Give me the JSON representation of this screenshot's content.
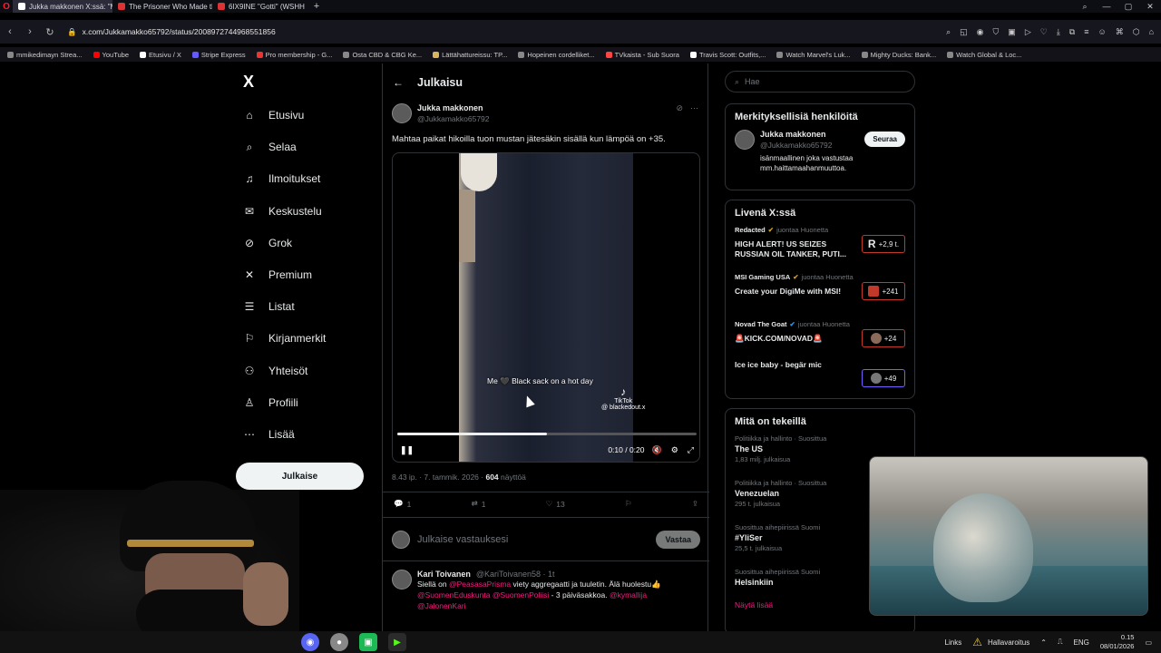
{
  "browser": {
    "tabs": [
      {
        "label": "Jukka makkonen X:ssä: \"M",
        "active": true
      },
      {
        "label": "The Prisoner Who Made th",
        "active": false
      },
      {
        "label": "6IX9INE \"Gotti\" (WSHH",
        "active": false
      }
    ],
    "new_tab": "+",
    "url": "x.com/Jukkamakko65792/status/2008972744968551856",
    "bookmarks": [
      "mmikedimayn Strea...",
      "YouTube",
      "Etusivu / X",
      "Stripe Express",
      "Pro membership - G...",
      "Osta CBD & CBG Ke...",
      "Lättähattureissu: TP...",
      "Hopeinen cordelliket...",
      "TVkaista - Sub Suora",
      "Travis Scott: Outfits,...",
      "Watch Marvel's Luk...",
      "Mighty Ducks: Bank...",
      "Watch Global & Loc..."
    ]
  },
  "nav": {
    "logo": "X",
    "items": [
      {
        "label": "Etusivu",
        "icon": "home-icon"
      },
      {
        "label": "Selaa",
        "icon": "search-icon"
      },
      {
        "label": "Ilmoitukset",
        "icon": "bell-icon"
      },
      {
        "label": "Keskustelu",
        "icon": "mail-icon"
      },
      {
        "label": "Grok",
        "icon": "grok-icon"
      },
      {
        "label": "Premium",
        "icon": "x-icon"
      },
      {
        "label": "Listat",
        "icon": "list-icon"
      },
      {
        "label": "Kirjanmerkit",
        "icon": "bookmark-icon"
      },
      {
        "label": "Yhteisöt",
        "icon": "people-icon"
      },
      {
        "label": "Profiili",
        "icon": "person-icon"
      },
      {
        "label": "Lisää",
        "icon": "more-icon"
      }
    ],
    "post_button": "Julkaise"
  },
  "post": {
    "header_title": "Julkaisu",
    "author_name": "Jukka makkonen",
    "author_handle": "@Jukkamakko65792",
    "text": "Mahtaa paikat hikoilla tuon mustan jätesäkin sisällä kun lämpöä on +35.",
    "video": {
      "caption": "Me 🖤 Black sack on a hot day",
      "watermark": "TikTok",
      "watermark_handle": "@ blackedout.x",
      "time": "0:10 / 0:20",
      "progress": 0.5
    },
    "meta_time": "8.43 ip. · 7. tammik. 2026 · ",
    "views_count": "604",
    "views_label": " näyttöä",
    "replies": "1",
    "reposts": "1",
    "likes": "13",
    "reply_placeholder": "Julkaise vastauksesi",
    "reply_button": "Vastaa"
  },
  "reply": {
    "name": "Kari Toivanen",
    "handle": "@KariToivanen58 · 1t",
    "text_1": "Siellä on ",
    "mention_1": "@PeasasaPrisma",
    "text_2": " viety aggregaatti ja tuuletin. Älä huolestu👍",
    "mention_2": "@SuomenEduskunta @SuomenPoliisi",
    "text_3": " - 3 päiväsakkoa. ",
    "mention_3": "@kymallija @JalonenKari"
  },
  "sidebar": {
    "search_placeholder": "Hae",
    "who_title": "Merkityksellisiä henkilöitä",
    "who_name": "Jukka makkonen",
    "who_handle": "@Jukkamakko65792",
    "who_bio": "isänmaallinen joka vastustaa mm.haittamaahanmuuttoa.",
    "follow_label": "Seuraa",
    "live_title": "Livenä X:ssä",
    "live": [
      {
        "source": "Redacted",
        "suffix": "juontaa Huonetta",
        "title": "HIGH ALERT! US SEIZES RUSSIAN OIL TANKER, PUTI...",
        "count": "+2,9 t."
      },
      {
        "source": "MSI Gaming USA",
        "suffix": "juontaa Huonetta",
        "title": "Create your DigiMe with MSI!",
        "count": "+241"
      },
      {
        "source": "Novad The Goat",
        "suffix": "juontaa Huonetta",
        "title": "🚨KICK.COM/NOVAD🚨",
        "count": "+24"
      },
      {
        "source": "",
        "suffix": "",
        "title": "Ice ice baby - begär mic",
        "count": "+49"
      }
    ],
    "happen_title": "Mitä on tekeillä",
    "happen": [
      {
        "category": "Politiikka ja hallinto · Suosittua",
        "title": "The US",
        "count": "1,83 milj. julkaisua"
      },
      {
        "category": "Politiikka ja hallinto · Suosittua",
        "title": "Venezuelan",
        "count": "295 t. julkaisua"
      },
      {
        "category": "Suosittua aihepiirissä Suomi",
        "title": "#YliSer",
        "count": "25,5 t. julkaisua"
      },
      {
        "category": "Suosittua aihepiirissä Suomi",
        "title": "Helsinkiin",
        "count": ""
      }
    ],
    "show_more": "Näytä lisää"
  },
  "taskbar": {
    "links": "Links",
    "warning": "Hallavaroitus",
    "lang": "ENG",
    "time": "0.15",
    "date": "08/01/2026"
  },
  "colors": {
    "accent": "#f91880",
    "x_blue": "#1d9bf0",
    "live_red": "#c0392b"
  }
}
